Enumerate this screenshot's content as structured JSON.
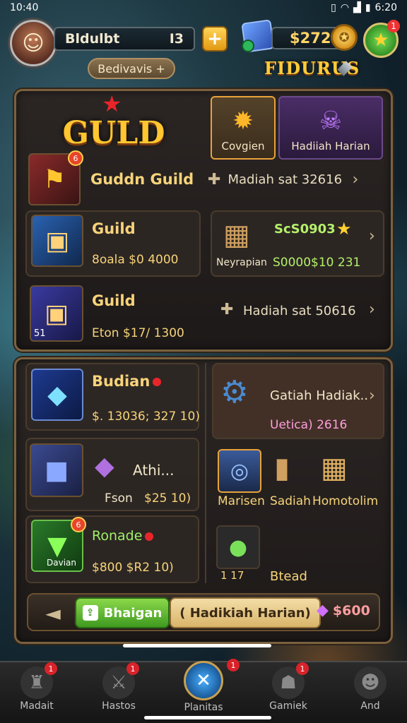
{
  "status": {
    "time": "10:40",
    "clock_right": "6:20"
  },
  "hud": {
    "player_name": "Bldulbt",
    "name_suffix": "I3",
    "plus_label": "+",
    "sub_pill": "Bedivavis +",
    "currency_value": "$272",
    "star_badge": "1",
    "title_logo": "FIDURUS"
  },
  "guild_panel": {
    "logo": "GULD",
    "tabs": [
      {
        "label": "Covgien",
        "icon": "sun-icon"
      },
      {
        "label": "Hadiiah Harian",
        "icon": "skull-icon"
      }
    ],
    "rows": [
      {
        "title": "Guddn Guild",
        "reward": "Madiah sat 32616",
        "badge": "6"
      },
      {
        "title": "Guild",
        "value": "8oala $0 4000"
      },
      {
        "title": "Guild",
        "value": "Eton $17/ 1300",
        "reward": "Hadiah sat 50616",
        "level": "51"
      }
    ],
    "right_cell": {
      "top": "ScS0903",
      "left_label": "Neyrapian",
      "value": "S0000$10 231"
    }
  },
  "second_panel": {
    "items": [
      {
        "title": "Budian",
        "value": "$. 13036; 327 10)"
      },
      {
        "title": "Athi...",
        "sub": "Fson",
        "value": "$25 10)"
      },
      {
        "title": "Ronade",
        "sub": "Davian",
        "value": "$800 $R2 10)"
      }
    ],
    "right_top": {
      "title": "Gatiah Hadiak..",
      "sub": "Uetica) 2616"
    },
    "trio": [
      "Marisen",
      "Sadiah",
      "Homotolim"
    ],
    "bottom_right": {
      "count": "1 17",
      "label": "Btead"
    }
  },
  "action_bar": {
    "back_label": "◄",
    "green_button": "Bhaigan",
    "cream_button": "( Hadikiah Harian)",
    "price": "$600"
  },
  "nav": [
    {
      "label": "Madait",
      "badge": "1"
    },
    {
      "label": "Hastos",
      "badge": "1"
    },
    {
      "label": "Planitas",
      "badge": "1"
    },
    {
      "label": "Gamiek",
      "badge": "1"
    },
    {
      "label": "And",
      "badge": ""
    }
  ]
}
